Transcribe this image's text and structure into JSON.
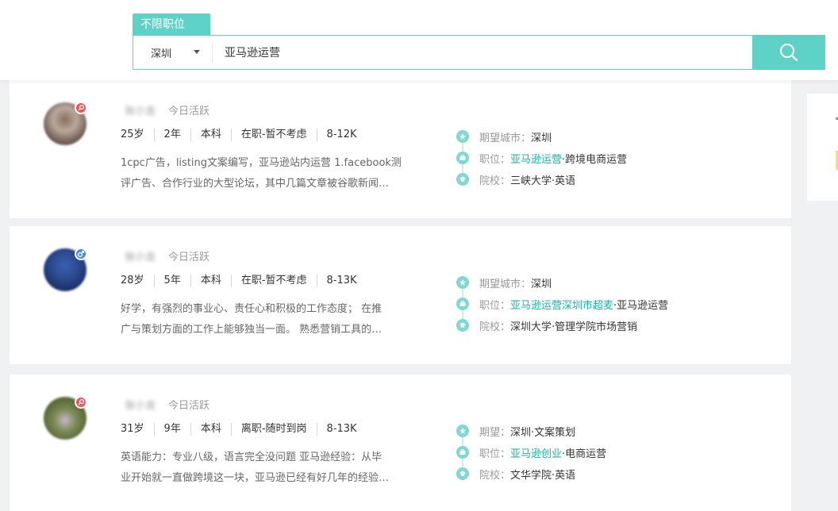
{
  "header": {
    "position_tab": "不限职位",
    "city": "深圳",
    "keyword": "亚马逊运营"
  },
  "colors": {
    "accent": "#5fd2c8",
    "highlight": "#1ab3a4",
    "female_badge": "#f2545b",
    "male_badge": "#4a90e2"
  },
  "cards": [
    {
      "name": "张小龙",
      "active": "今日活跃",
      "gender_icon": "female-icon",
      "info": [
        "25岁",
        "2年",
        "本科",
        "在职-暂不考虑",
        "8-12K"
      ],
      "desc": [
        "1cpc广告，listing文案编写，亚马逊站内运营 1.facebook测",
        "评广告、合作行业的大型论坛，其中几篇文章被谷歌新闻…"
      ],
      "meta": [
        {
          "label": "期望城市：",
          "highlight": "",
          "value": "深圳"
        },
        {
          "label": "职位：",
          "highlight": "亚马逊运营",
          "value": "·跨境电商运营"
        },
        {
          "label": "院校：",
          "highlight": "",
          "value": "三峡大学·英语"
        }
      ]
    },
    {
      "name": "张小龙",
      "active": "今日活跃",
      "gender_icon": "male-icon",
      "info": [
        "28岁",
        "5年",
        "本科",
        "在职-暂不考虑",
        "8-13K"
      ],
      "desc": [
        "好学，有强烈的事业心、责任心和积极的工作态度； 在推",
        "广与策划方面的工作上能够独当一面。 熟悉营销工具的…"
      ],
      "meta": [
        {
          "label": "期望城市：",
          "highlight": "",
          "value": "深圳"
        },
        {
          "label": "职位：",
          "highlight": "亚马逊运营深圳市超麦",
          "value": "·亚马逊运营"
        },
        {
          "label": "院校：",
          "highlight": "",
          "value": "深圳大学·管理学院市场营销"
        }
      ]
    },
    {
      "name": "张小龙",
      "active": "今日活跃",
      "gender_icon": "female-icon",
      "info": [
        "31岁",
        "9年",
        "本科",
        "离职-随时到岗",
        "8-13K"
      ],
      "desc": [
        "英语能力：专业八级，语言完全没问题 亚马逊经验：从毕",
        "业开始就一直做跨境这一块，亚马逊已经有好几年的经验…"
      ],
      "meta": [
        {
          "label": "期望：",
          "highlight": "",
          "value": "深圳·文案策划"
        },
        {
          "label": "职位：",
          "highlight": "亚马逊创业",
          "value": "·电商运营"
        },
        {
          "label": "院校：",
          "highlight": "",
          "value": "文华学院·英语"
        }
      ]
    }
  ]
}
